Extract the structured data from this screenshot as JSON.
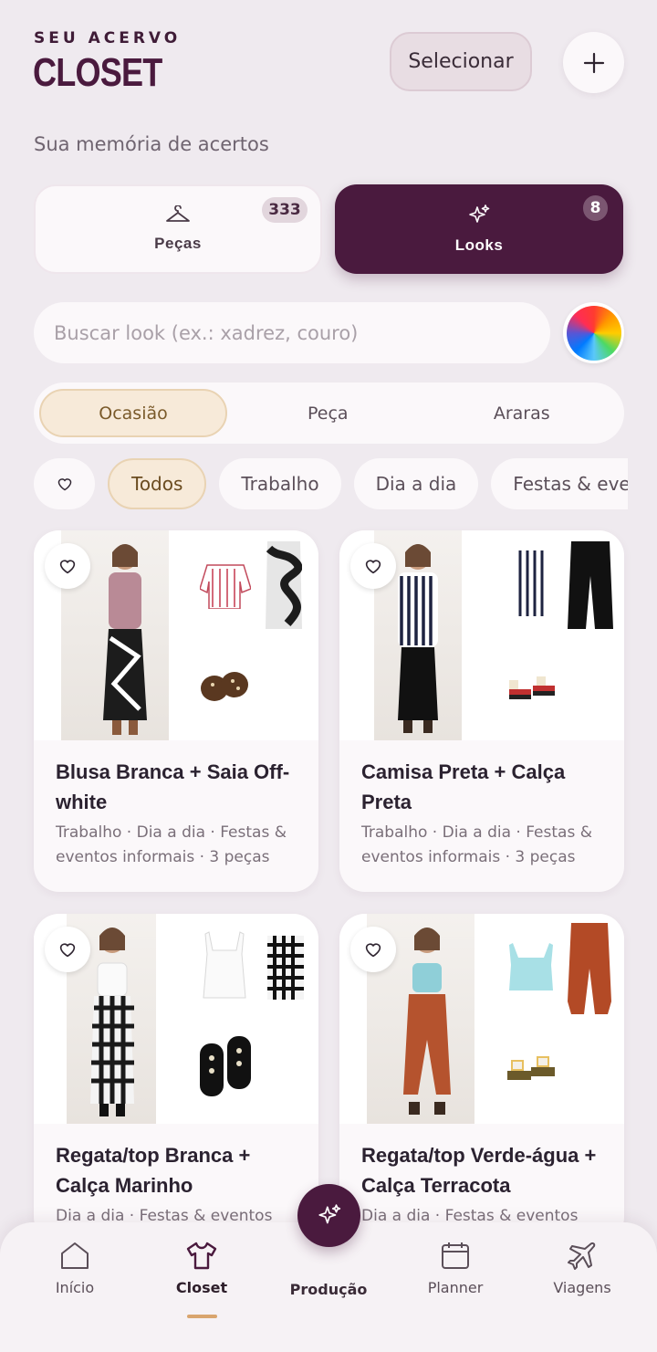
{
  "header": {
    "eyebrow": "SEU ACERVO",
    "title": "CLOSET",
    "select_label": "Selecionar",
    "subtitle": "Sua memória de acertos"
  },
  "segments": {
    "pecas": {
      "label": "Peças",
      "count": "333",
      "icon": "hanger-icon"
    },
    "looks": {
      "label": "Looks",
      "count": "8",
      "icon": "sparkles-icon"
    }
  },
  "search": {
    "placeholder": "Buscar look (ex.: xadrez, couro)"
  },
  "filter_tabs": [
    "Ocasião",
    "Peça",
    "Araras"
  ],
  "chips": [
    "Todos",
    "Trabalho",
    "Dia a dia",
    "Festas & eve"
  ],
  "looks": [
    {
      "title": "Blusa Branca + Saia Off-white",
      "meta": "Trabalho · Dia a dia · Festas & eventos informais · 3 peças"
    },
    {
      "title": "Camisa Preta + Calça Preta",
      "meta": "Trabalho · Dia a dia · Festas & eventos informais · 3 peças"
    },
    {
      "title": "Regata/top Branca + Calça Marinho",
      "meta": "Dia a dia · Festas & eventos"
    },
    {
      "title": "Regata/top Verde-água + Calça Terracota",
      "meta": "Dia a dia · Festas & eventos"
    }
  ],
  "nav": {
    "inicio": "Início",
    "closet": "Closet",
    "producao": "Produção",
    "planner": "Planner",
    "viagens": "Viagens"
  },
  "colors": {
    "primary": "#4a1a3e",
    "accent": "#f7ead9",
    "background": "#efeaef"
  }
}
